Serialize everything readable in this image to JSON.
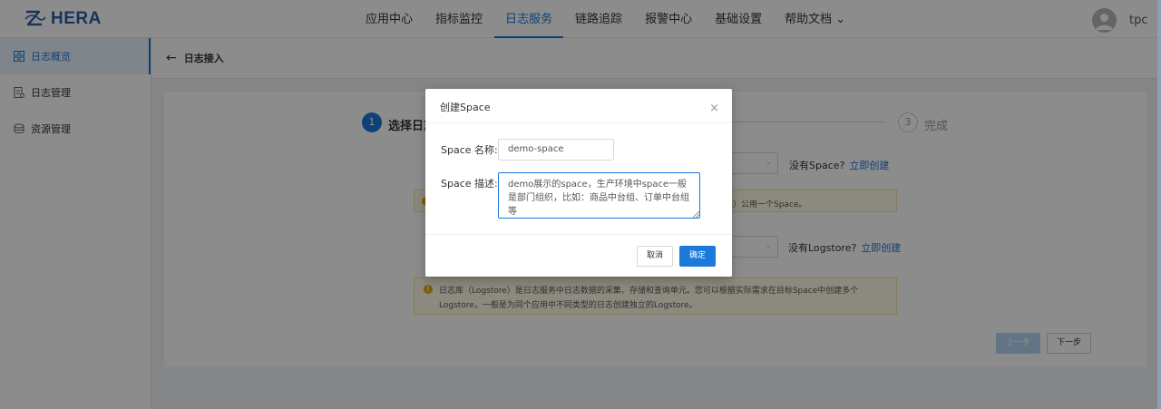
{
  "header": {
    "logo_text": "HERA",
    "nav": [
      "应用中心",
      "指标监控",
      "日志服务",
      "链路追踪",
      "报警中心",
      "基础设置",
      "帮助文档"
    ],
    "nav_active_index": 2,
    "help_chevron": "⌄",
    "username": "tpc"
  },
  "sidebar": {
    "items": [
      {
        "label": "日志概览",
        "icon": "overview-icon"
      },
      {
        "label": "日志管理",
        "icon": "log-manage-icon"
      },
      {
        "label": "资源管理",
        "icon": "resource-icon"
      }
    ],
    "active_index": 0
  },
  "page": {
    "back_arrow": "←",
    "title": "日志接入"
  },
  "steps": {
    "step1_num": "1",
    "step1_label": "选择日志",
    "step3_num": "3",
    "step3_label": "完成"
  },
  "form": {
    "no_space_text": "没有Space?",
    "create_now_1": "立即创建",
    "space_hint_tail": "三级）公用一个Space。",
    "no_logstore_text": "没有Logstore?",
    "create_now_2": "立即创建",
    "logstore_hint": "日志库（Logstore）是日志服务中日志数据的采集、存储和查询单元。您可以根据实际需求在目标Space中创建多个Logstore，一般是为同个应用中不同类型的日志创建独立的Logstore。",
    "prev_button": "上一步",
    "next_button": "下一步"
  },
  "modal": {
    "title": "创建Space",
    "close_glyph": "×",
    "name_label": "Space 名称:",
    "name_value": "demo-space",
    "desc_label": "Space 描述:",
    "desc_value": "demo展示的space，生产环境中space一般是部门组织，比如：商品中台组、订单中台组等",
    "cancel_button": "取消",
    "ok_button": "确定"
  },
  "colors": {
    "primary": "#1a79d9",
    "logo": "#2c5fa8",
    "warning": "#e8a800"
  }
}
